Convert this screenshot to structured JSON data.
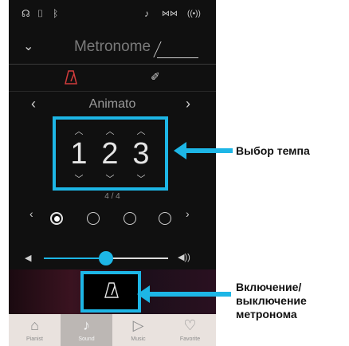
{
  "statusbar": {
    "icons": [
      "headphones-icon",
      "usb-icon",
      "bluetooth-icon",
      "sound-icon",
      "wifi-icon",
      "signal-icon"
    ]
  },
  "header": {
    "title": "Metronome"
  },
  "mode_tabs": {
    "selected": "metronome"
  },
  "tempo": {
    "name": "Animato",
    "digits": [
      "1",
      "2",
      "3"
    ]
  },
  "beat": {
    "label": "4 / 4",
    "count": 4,
    "selected_index": 0
  },
  "volume": {
    "level": 0.5
  },
  "tabbar": {
    "tabs": [
      {
        "label": "Pianist"
      },
      {
        "label": "Sound"
      },
      {
        "label": "Music"
      },
      {
        "label": "Favorite"
      }
    ],
    "active_index": 1
  },
  "callouts": {
    "tempo_select": "Выбор темпа",
    "toggle_line1": "Включение/",
    "toggle_line2": "выключение",
    "toggle_line3": "метронома"
  },
  "colors": {
    "accent": "#1db6e6",
    "metronome_active": "#d33c3c",
    "background": "#101010"
  }
}
